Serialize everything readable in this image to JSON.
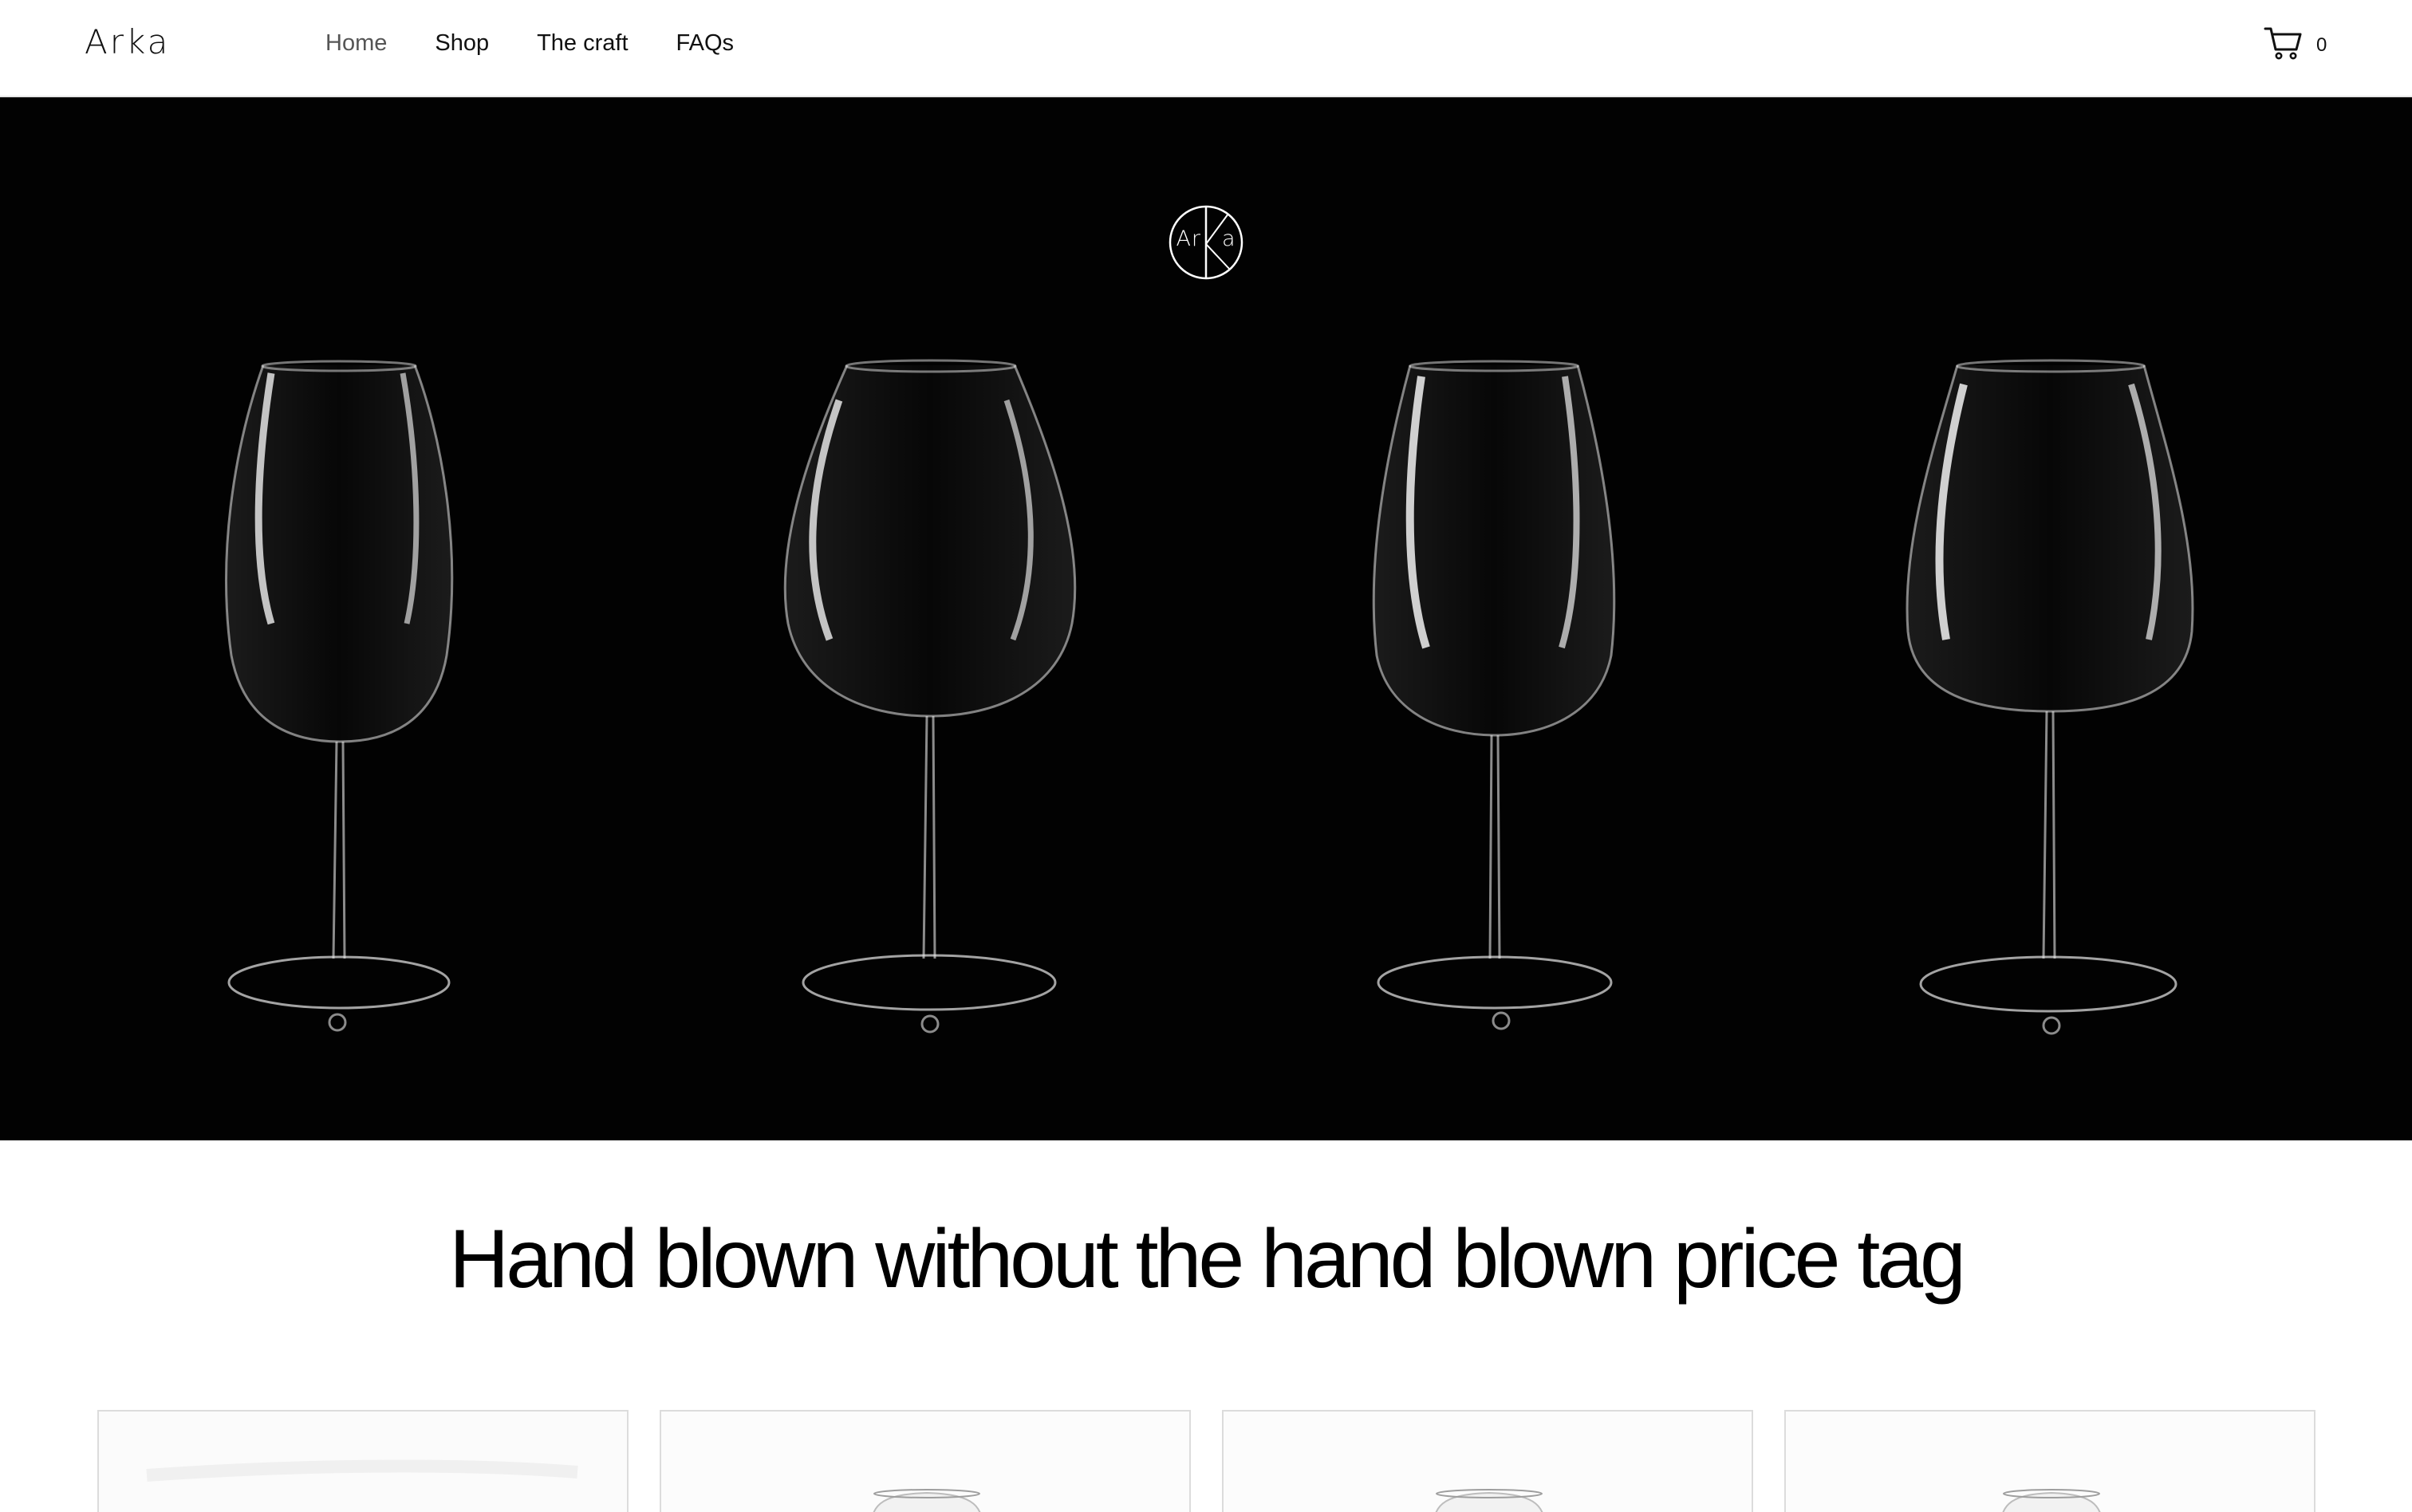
{
  "header": {
    "brand": "Arka",
    "nav": [
      {
        "label": "Home",
        "active": true
      },
      {
        "label": "Shop",
        "active": false
      },
      {
        "label": "The craft",
        "active": false
      },
      {
        "label": "FAQs",
        "active": false
      }
    ],
    "cart_icon": "cart-icon",
    "cart_count": "0"
  },
  "hero": {
    "logo_letters_left": "Ar",
    "logo_letters_right": "a",
    "logo_icon": "arka-monogram-icon",
    "background_color": "#020202",
    "glasses": [
      "wine-glass-1",
      "wine-glass-2",
      "wine-glass-3",
      "wine-glass-4"
    ]
  },
  "main": {
    "tagline": "Hand blown without the hand blown price tag"
  },
  "products": {
    "count_visible": 4,
    "card_border_color": "#dcdcdc"
  }
}
